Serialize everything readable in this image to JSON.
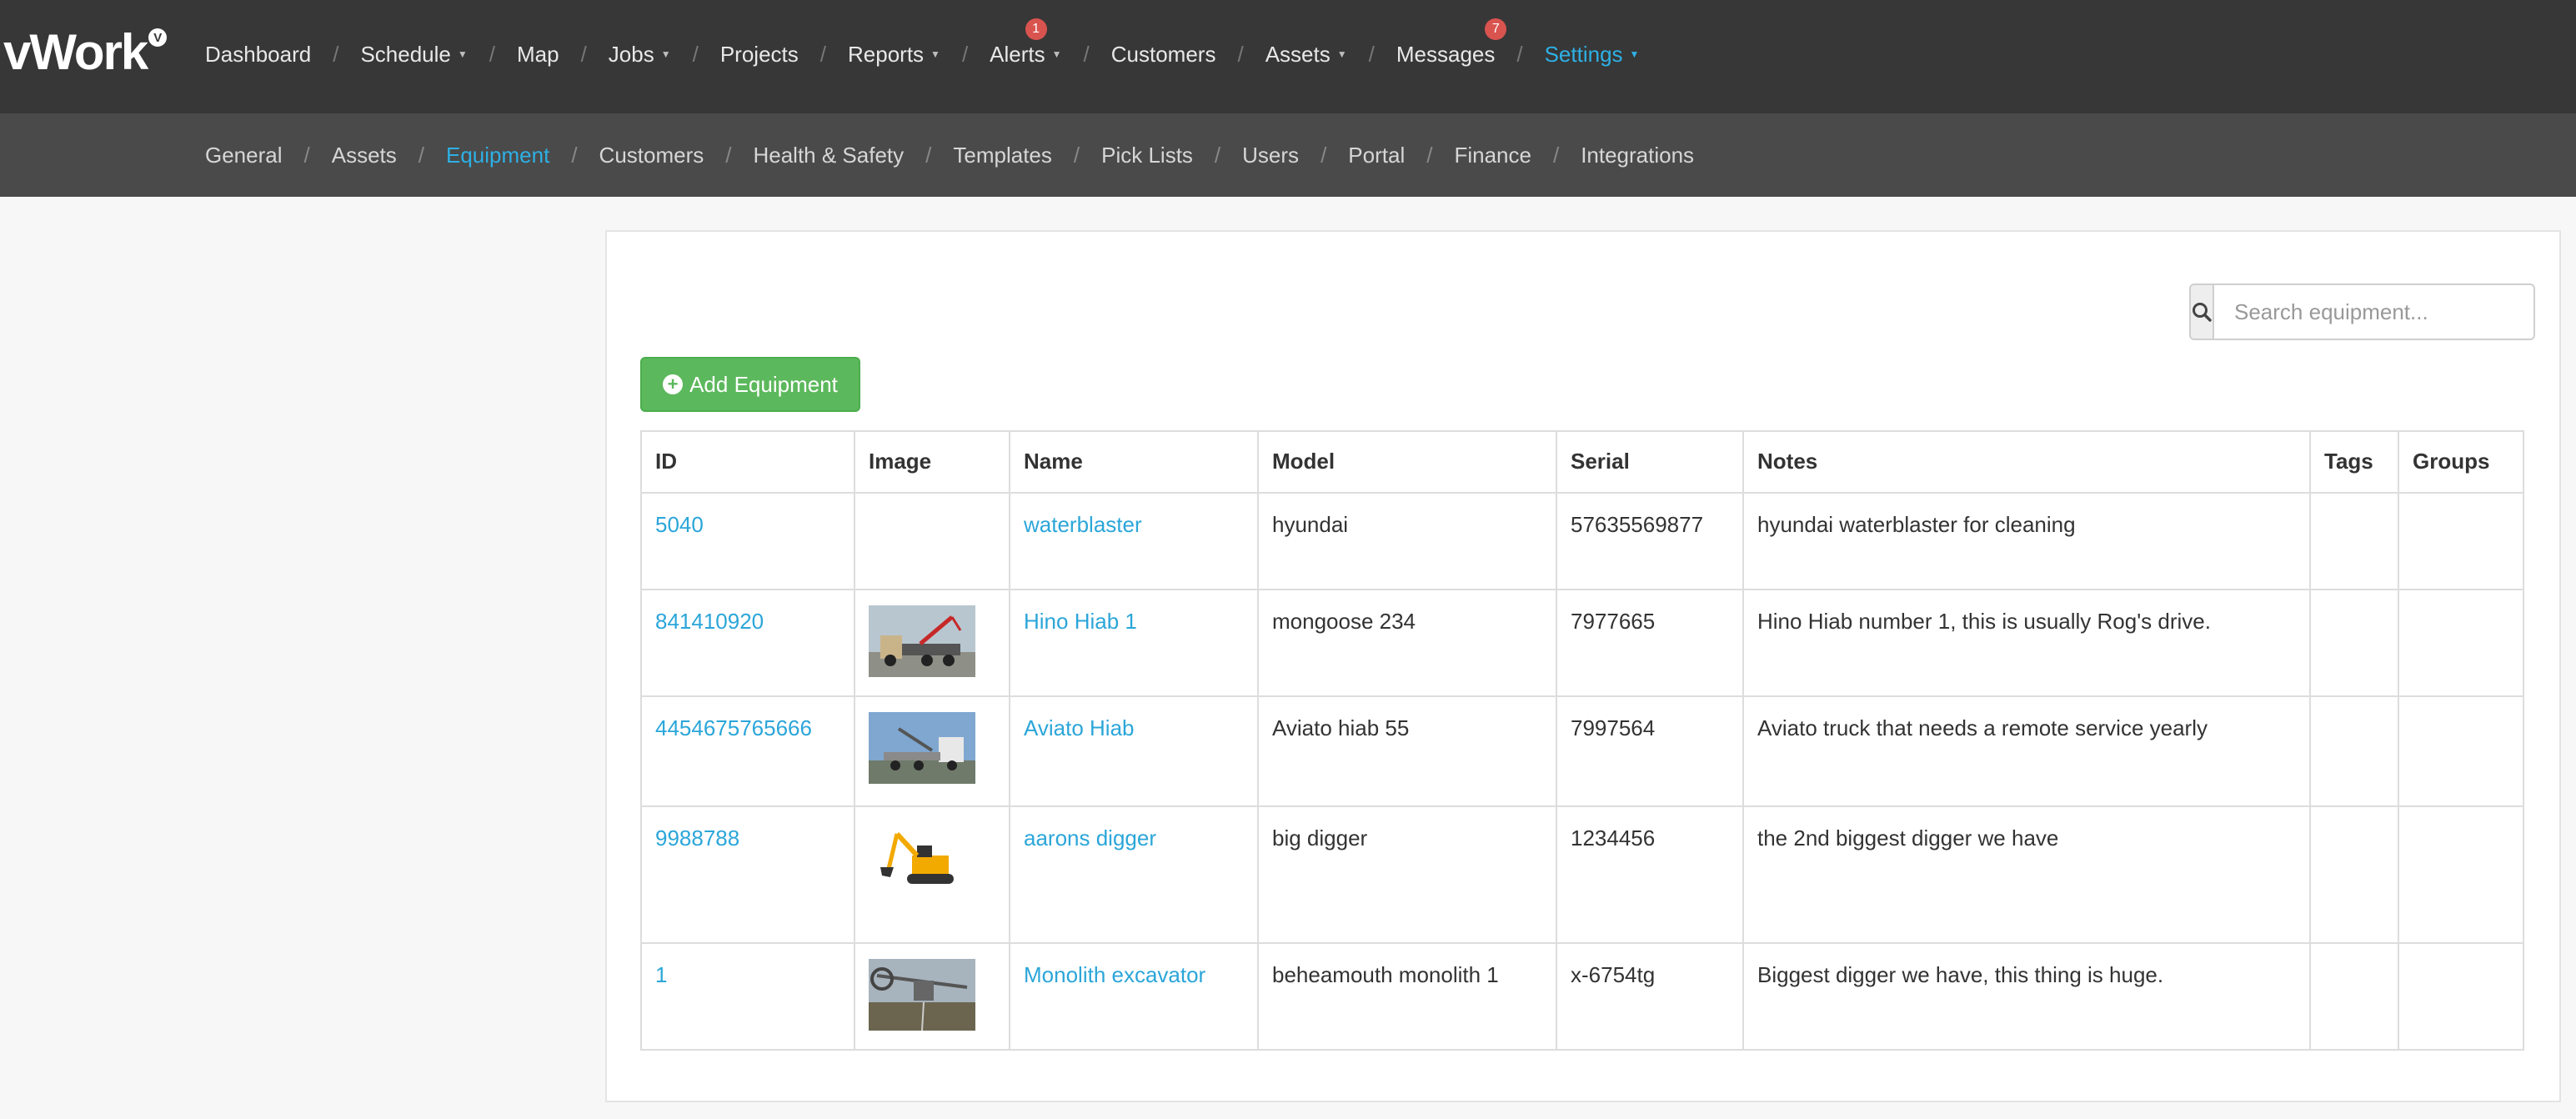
{
  "brand": {
    "name": "vWork",
    "badge": "V"
  },
  "topnav": {
    "items": [
      {
        "label": "Dashboard",
        "caret": false
      },
      {
        "label": "Schedule",
        "caret": true
      },
      {
        "label": "Map",
        "caret": false
      },
      {
        "label": "Jobs",
        "caret": true
      },
      {
        "label": "Projects",
        "caret": false
      },
      {
        "label": "Reports",
        "caret": true
      },
      {
        "label": "Alerts",
        "caret": true,
        "badge": "1"
      },
      {
        "label": "Customers",
        "caret": false
      },
      {
        "label": "Assets",
        "caret": true
      },
      {
        "label": "Messages",
        "caret": false,
        "badge": "7"
      },
      {
        "label": "Settings",
        "caret": true,
        "active": true
      }
    ]
  },
  "subnav": {
    "items": [
      {
        "label": "General"
      },
      {
        "label": "Assets"
      },
      {
        "label": "Equipment",
        "active": true
      },
      {
        "label": "Customers"
      },
      {
        "label": "Health & Safety"
      },
      {
        "label": "Templates"
      },
      {
        "label": "Pick Lists"
      },
      {
        "label": "Users"
      },
      {
        "label": "Portal"
      },
      {
        "label": "Finance"
      },
      {
        "label": "Integrations"
      }
    ]
  },
  "search": {
    "placeholder": "Search equipment..."
  },
  "add_button": {
    "label": "Add Equipment"
  },
  "table": {
    "columns": [
      "ID",
      "Image",
      "Name",
      "Model",
      "Serial",
      "Notes",
      "Tags",
      "Groups"
    ],
    "rows": [
      {
        "id": "5040",
        "image": "",
        "name": "waterblaster",
        "model": "hyundai",
        "serial": "57635569877",
        "notes": "hyundai waterblaster for cleaning",
        "tags": "",
        "groups": ""
      },
      {
        "id": "841410920",
        "image": "truck-crane",
        "name": "Hino Hiab 1",
        "model": "mongoose 234",
        "serial": "7977665",
        "notes": "Hino Hiab number 1, this is usually Rog's drive.",
        "tags": "",
        "groups": ""
      },
      {
        "id": "4454675765666",
        "image": "flatbed-truck",
        "name": "Aviato Hiab",
        "model": "Aviato hiab 55",
        "serial": "7997564",
        "notes": "Aviato truck that needs a remote service yearly",
        "tags": "",
        "groups": ""
      },
      {
        "id": "9988788",
        "image": "excavator",
        "name": "aarons digger",
        "model": "big digger",
        "serial": "1234456",
        "notes": "the 2nd biggest digger we have",
        "tags": "",
        "groups": ""
      },
      {
        "id": "1",
        "image": "bucket-wheel-excavator",
        "name": "Monolith excavator",
        "model": "beheamouth monolith 1",
        "serial": "x-6754tg",
        "notes": "Biggest digger we have, this thing is huge.",
        "tags": "",
        "groups": ""
      }
    ]
  }
}
